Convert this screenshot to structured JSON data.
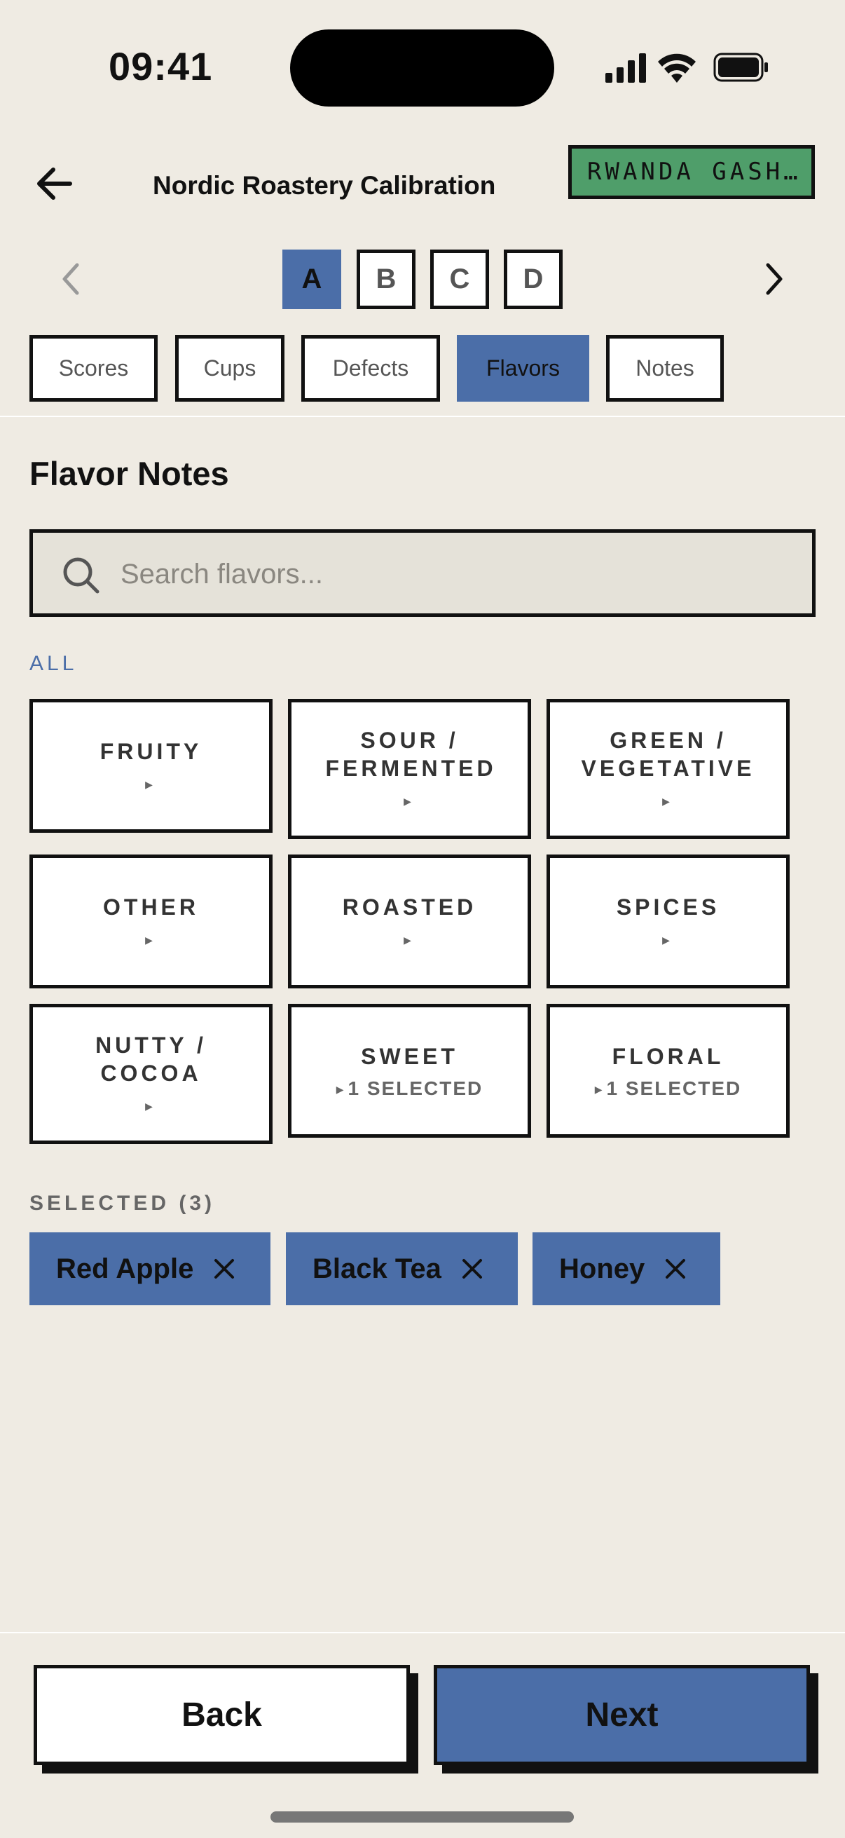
{
  "status_bar": {
    "time": "09:41"
  },
  "header": {
    "title": "Nordic Roastery Calibration",
    "lot_tag": "RWANDA GASH…"
  },
  "samples": {
    "items": [
      "A",
      "B",
      "C",
      "D"
    ],
    "active": "A"
  },
  "tabs": {
    "items": [
      "Scores",
      "Cups",
      "Defects",
      "Flavors",
      "Notes"
    ],
    "active": "Flavors"
  },
  "section": {
    "title": "Flavor Notes"
  },
  "search": {
    "placeholder": "Search flavors..."
  },
  "filter": {
    "label": "ALL"
  },
  "categories": [
    {
      "name": "FRUITY",
      "sub": ""
    },
    {
      "name": "SOUR / FERMENTED",
      "sub": ""
    },
    {
      "name": "GREEN / VEGETATIVE",
      "sub": ""
    },
    {
      "name": "OTHER",
      "sub": ""
    },
    {
      "name": "ROASTED",
      "sub": ""
    },
    {
      "name": "SPICES",
      "sub": ""
    },
    {
      "name": "NUTTY / COCOA",
      "sub": ""
    },
    {
      "name": "SWEET",
      "sub": "1 SELECTED"
    },
    {
      "name": "FLORAL",
      "sub": "1 SELECTED"
    }
  ],
  "selected": {
    "label": "SELECTED (3)",
    "chips": [
      "Red Apple",
      "Black Tea",
      "Honey"
    ]
  },
  "footer": {
    "back_label": "Back",
    "next_label": "Next"
  },
  "colors": {
    "accent": "#4b6ea8",
    "tag_green": "#4f9e6a",
    "background": "#efebe3"
  }
}
